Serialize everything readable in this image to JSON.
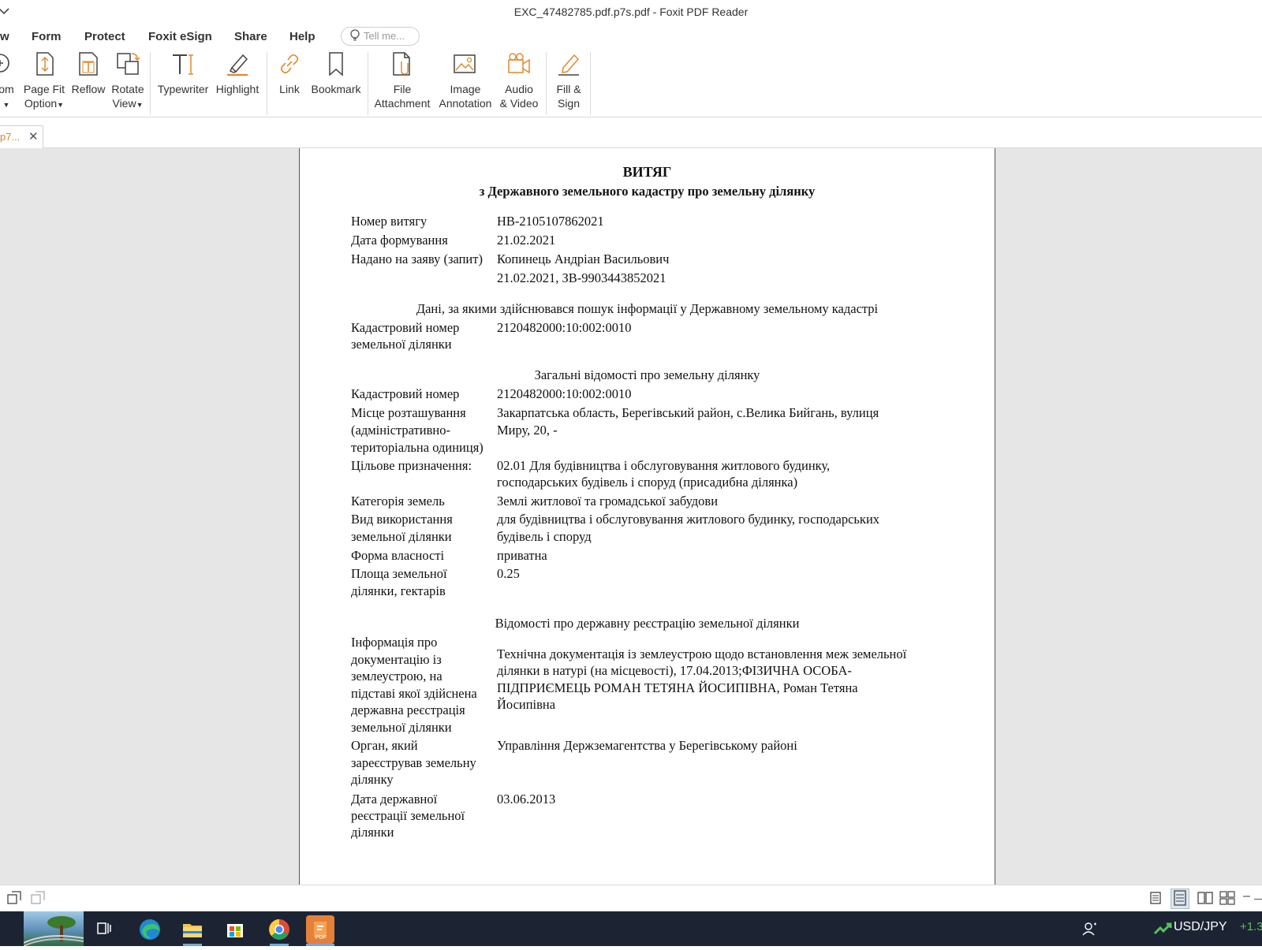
{
  "window": {
    "title": "EXC_47482785.pdf.p7s.pdf - Foxit PDF Reader"
  },
  "menu": {
    "partial_left": "w",
    "items": [
      "Form",
      "Protect",
      "Foxit eSign",
      "Share",
      "Help"
    ],
    "tellme_placeholder": "Tell me..."
  },
  "ribbon": {
    "zoom_partial": "om",
    "page_fit_l1": "Page Fit",
    "page_fit_l2": "Option",
    "reflow": "Reflow",
    "rotate_l1": "Rotate",
    "rotate_l2": "View",
    "typewriter": "Typewriter",
    "highlight": "Highlight",
    "link": "Link",
    "bookmark": "Bookmark",
    "file_l1": "File",
    "file_l2": "Attachment",
    "image_l1": "Image",
    "image_l2": "Annotation",
    "audio_l1": "Audio",
    "audio_l2": "& Video",
    "fill_l1": "Fill &",
    "fill_l2": "Sign"
  },
  "tab": {
    "label": "p7..."
  },
  "document": {
    "title": "ВИТЯГ",
    "subtitle": "з Державного земельного кадастру про земельну ділянку",
    "header_rows": [
      {
        "label": "Номер витягу",
        "value": "НВ-2105107862021"
      },
      {
        "label": "Дата формування",
        "value": "21.02.2021"
      },
      {
        "label": "Надано на заяву (запит)",
        "value": "Копинець Андріан Васильович"
      },
      {
        "label": "",
        "value": "21.02.2021, ЗВ-9903443852021"
      }
    ],
    "section1": {
      "heading": "Дані, за якими здійснювався пошук інформації у Державному земельному кадастрі",
      "label_l1": "Кадастровий номер",
      "label_l2": "земельної ділянки",
      "value": "2120482000:10:002:0010"
    },
    "section2": {
      "heading": "Загальні відомості про земельну ділянку",
      "cad_label": "Кадастровий номер",
      "cad_value": "2120482000:10:002:0010",
      "loc_label_l1": "Місце розташування",
      "loc_label_l2": "(адміністративно-",
      "loc_label_l3": "територіальна одиниця)",
      "loc_value_l1": "Закарпатська область, Берегівський район, с.Велика Бийгань, вулиця",
      "loc_value_l2": "Миру, 20, -",
      "purpose_label": "Цільове призначення:",
      "purpose_l1": "02.01 Для будівництва і обслуговування житлового будинку,",
      "purpose_l2": "господарських будівель і споруд (присадибна ділянка)",
      "cat_label": "Категорія земель",
      "cat_value": "Землі житлової та громадської забудови",
      "use_label_l1": "Вид використання",
      "use_label_l2": "земельної ділянки",
      "use_l1": "для будівництва і обслуговування житлового будинку, господарських",
      "use_l2": "будівель і споруд",
      "own_label": "Форма власності",
      "own_value": "приватна",
      "area_label_l1": "Площа земельної",
      "area_label_l2": "ділянки, гектарів",
      "area_value": "0.25"
    },
    "section3": {
      "heading": "Відомості про державну реєстрацію земельної ділянки",
      "doc_label": [
        "Інформація про",
        "документацію із",
        "землеустрою, на",
        "підставі якої здійснена",
        "державна реєстрація",
        "земельної ділянки"
      ],
      "doc_value": [
        "Технічна документація із землеустрою щодо встановлення меж земельної",
        "ділянки в натурі (на місцевості), 17.04.2013;ФІЗИЧНА ОСОБА-",
        "ПІДПРИЄМЕЦЬ РОМАН ТЕТЯНА ЙОСИПІВНА, Роман Тетяна",
        "Йосипівна"
      ],
      "org_label": [
        "Орган, який",
        "зареєстрував земельну",
        "ділянку"
      ],
      "org_value": "Управління Держземагентства у Берегівському районі",
      "date_label": [
        "Дата державної",
        "реєстрації земельної",
        "ділянки"
      ],
      "date_value": "03.06.2013"
    }
  },
  "taskbar": {
    "fx_pair": "USD/JPY",
    "fx_change": "+1.3"
  },
  "colors": {
    "accent_orange": "#d9822b",
    "taskbar": "#1c2433",
    "positive": "#58c05a"
  }
}
